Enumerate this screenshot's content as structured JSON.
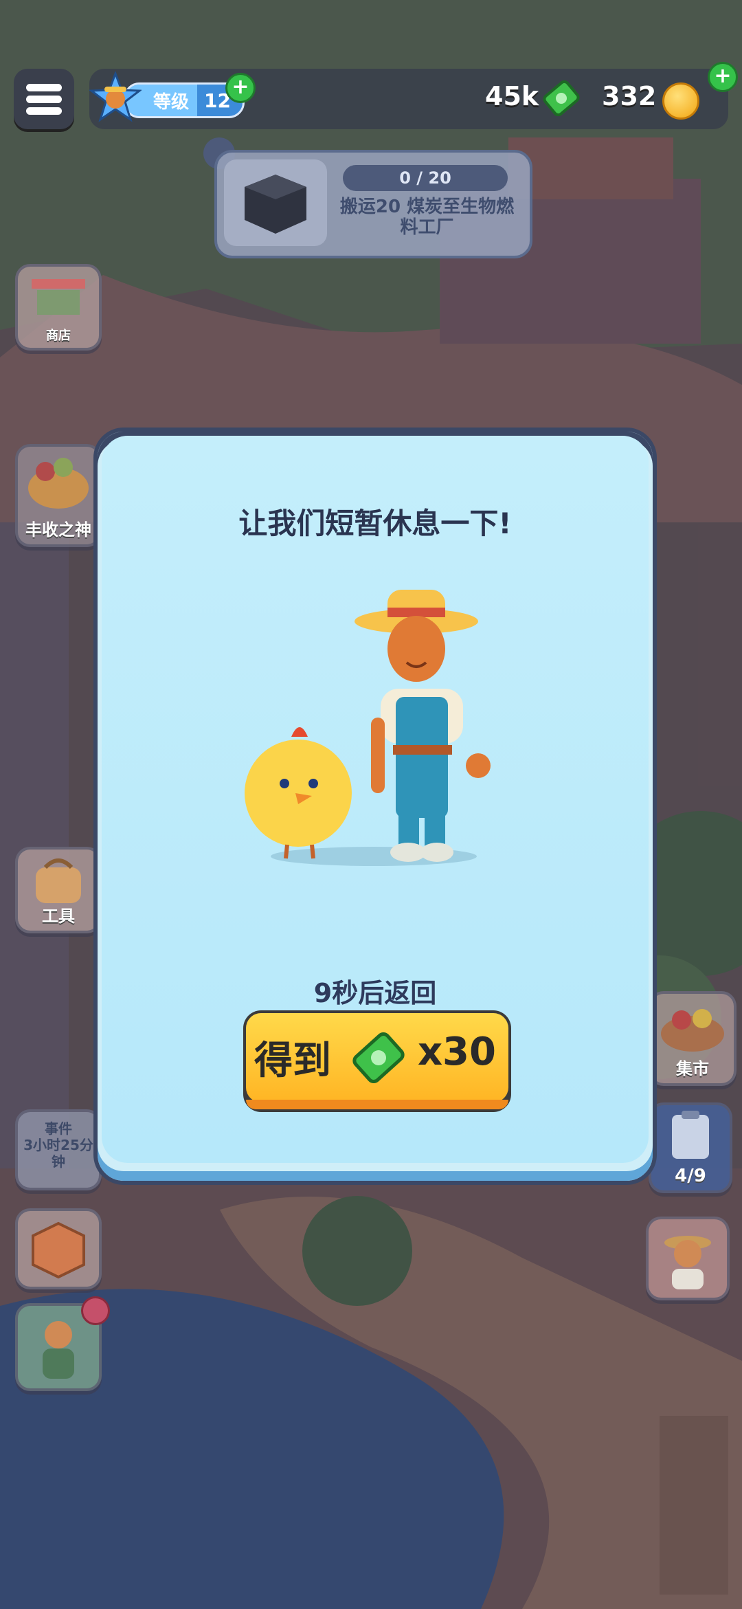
{
  "hud": {
    "level_label": "等级",
    "level_value": "12",
    "cash": "45k",
    "coins": "332",
    "plus": "+"
  },
  "quest": {
    "progress": "0 / 20",
    "description": "搬运20 煤炭至生物燃料工厂"
  },
  "side_left": {
    "shop": "商店",
    "harvest_god": "丰收之神",
    "tools": "工具",
    "event_title": "事件",
    "event_time": "3小时25分钟"
  },
  "side_right": {
    "market": "集市",
    "tasks_progress": "4/9"
  },
  "dialog": {
    "title": "让我们短暂休息一下!",
    "countdown": "9秒后返回",
    "claim_label": "得到",
    "claim_multiplier": "x30"
  },
  "colors": {
    "dialog_bg": "#cfeef8",
    "button_yellow": "#ffc43a",
    "cash_green": "#3fc14a",
    "level_blue": "#3c8bd9"
  }
}
